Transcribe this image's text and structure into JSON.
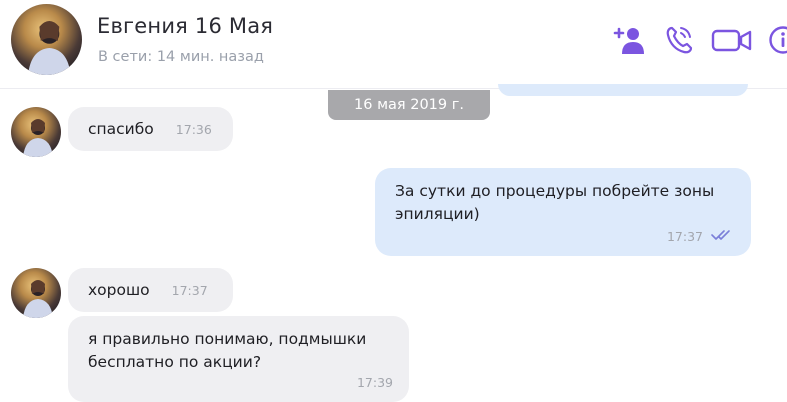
{
  "header": {
    "contact_name": "Евгения 16 Мая",
    "status": "В сети: 14 мин. назад",
    "icons": [
      "add-contact-icon",
      "phone-icon",
      "video-icon",
      "info-icon"
    ]
  },
  "date_divider": "16 мая 2019 г.",
  "messages": [
    {
      "direction": "incoming",
      "text": "спасибо",
      "time": "17:36"
    },
    {
      "direction": "outgoing",
      "text": "За сутки до процедуры побрейте зоны эпиляции)",
      "time": "17:37",
      "read": true
    },
    {
      "direction": "incoming",
      "text": "хорошо",
      "time": "17:37"
    },
    {
      "direction": "incoming",
      "text": "я правильно понимаю, подмышки бесплатно по акции?",
      "time": "17:39"
    }
  ],
  "colors": {
    "accent": "#7b55e0",
    "incoming_bubble": "#efeff2",
    "outgoing_bubble": "#ddeafb",
    "date_pill": "#a8a8ab"
  }
}
